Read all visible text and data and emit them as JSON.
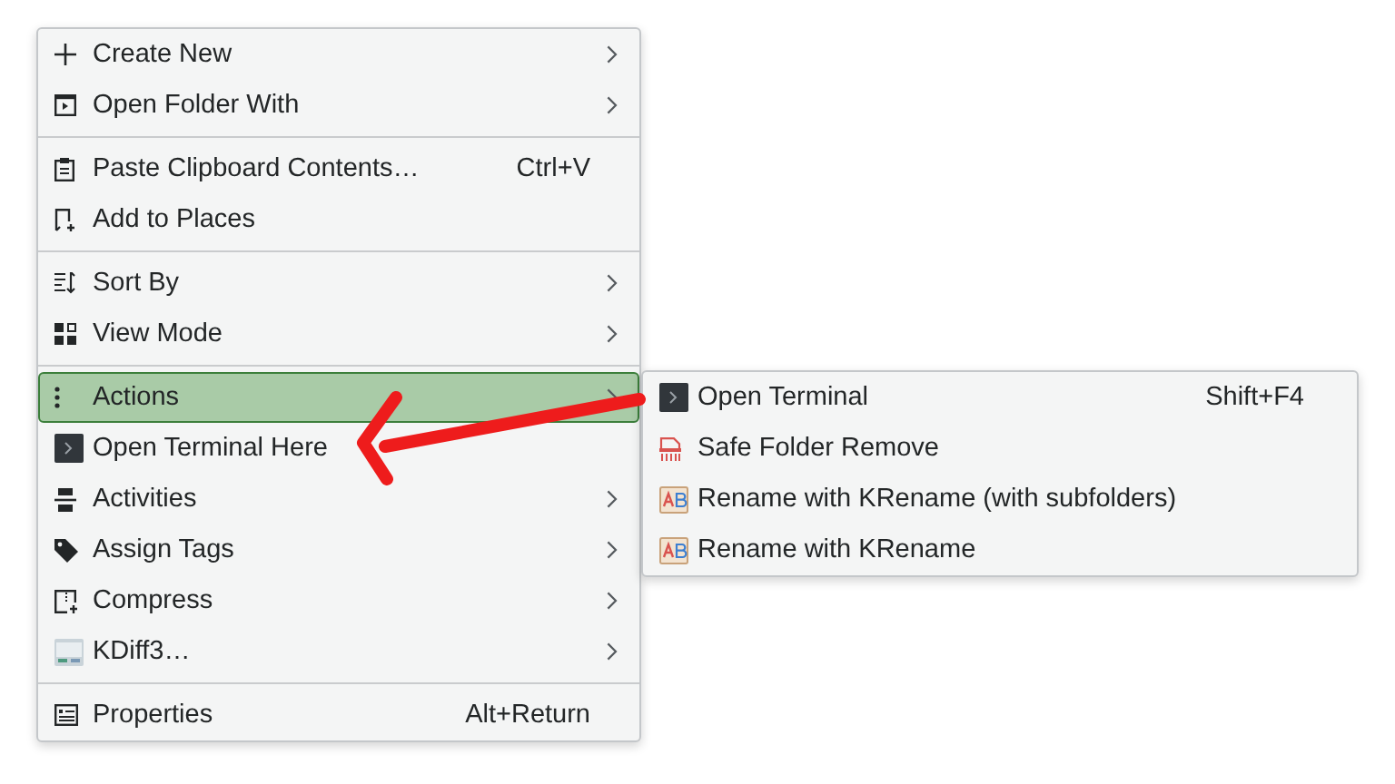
{
  "menu": {
    "sections": [
      [
        {
          "label": "Create New",
          "submenu": true,
          "selected": false
        },
        {
          "label": "Open Folder With",
          "submenu": true,
          "selected": false
        }
      ],
      [
        {
          "label": "Paste Clipboard Contents…",
          "shortcut": "Ctrl+V",
          "submenu": false,
          "selected": false
        },
        {
          "label": "Add to Places",
          "submenu": false,
          "selected": false
        }
      ],
      [
        {
          "label": "Sort By",
          "submenu": true,
          "selected": false
        },
        {
          "label": "View Mode",
          "submenu": true,
          "selected": false
        }
      ],
      [
        {
          "label": "Actions",
          "submenu": true,
          "selected": true
        },
        {
          "label": "Open Terminal Here",
          "submenu": false,
          "selected": false
        },
        {
          "label": "Activities",
          "submenu": true,
          "selected": false
        },
        {
          "label": "Assign Tags",
          "submenu": true,
          "selected": false
        },
        {
          "label": "Compress",
          "submenu": true,
          "selected": false
        },
        {
          "label": "KDiff3…",
          "submenu": true,
          "selected": false
        }
      ],
      [
        {
          "label": "Properties",
          "shortcut": "Alt+Return",
          "submenu": false,
          "selected": false
        }
      ]
    ]
  },
  "submenu": {
    "items": [
      {
        "label": "Open Terminal",
        "shortcut": "Shift+F4"
      },
      {
        "label": "Safe Folder Remove"
      },
      {
        "label": "Rename with KRename (with subfolders)"
      },
      {
        "label": "Rename with KRename"
      }
    ]
  }
}
